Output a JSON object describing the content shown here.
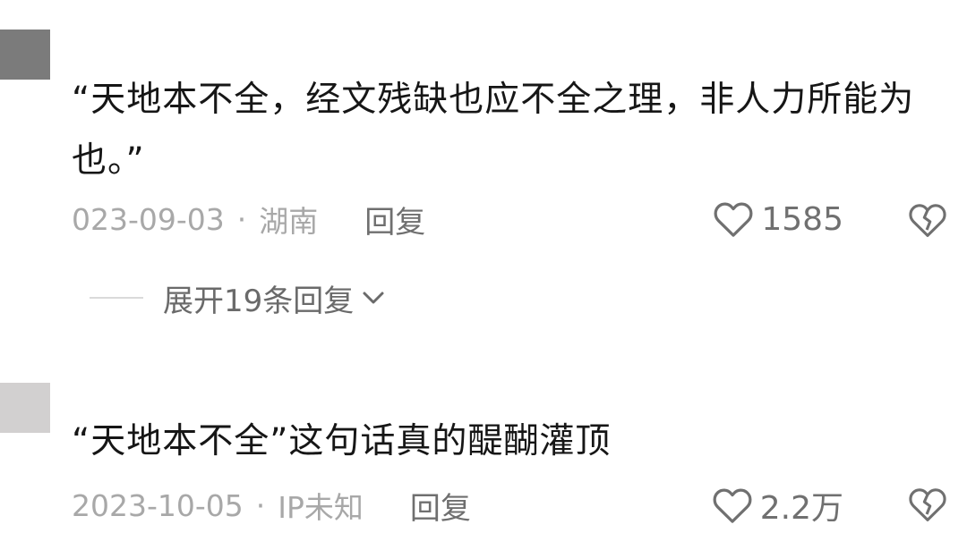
{
  "comments": [
    {
      "text": "“天地本不全，经文残缺也应不全之理，非人力所能为也。”",
      "date": "023-09-03",
      "dot": "·",
      "location": "湖南",
      "reply_label": "回复",
      "likes": "1585",
      "expand_label": "展开19条回复"
    },
    {
      "text": "“天地本不全”这句话真的醍醐灌顶",
      "date": "2023-10-05",
      "dot": "·",
      "location": "IP未知",
      "reply_label": "回复",
      "likes": "2.2万"
    }
  ],
  "icons": {
    "like": "heart-outline-icon",
    "dislike": "broken-heart-icon",
    "expand": "chevron-down-icon"
  },
  "colors": {
    "text": "#161616",
    "meta": "#a8a8a8",
    "icon": "#707070"
  }
}
